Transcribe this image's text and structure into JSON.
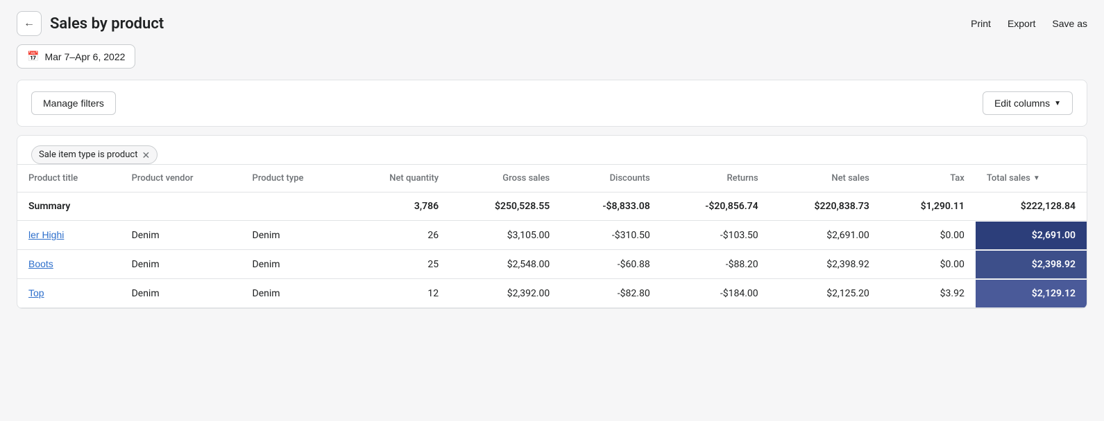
{
  "header": {
    "title": "Sales by product",
    "back_label": "←",
    "actions": {
      "print": "Print",
      "export": "Export",
      "save_as": "Save as"
    }
  },
  "date_filter": {
    "label": "Mar 7–Apr 6, 2022"
  },
  "filters_section": {
    "manage_filters_label": "Manage filters",
    "edit_columns_label": "Edit columns",
    "active_filter": "Sale item type is product"
  },
  "table": {
    "columns": [
      {
        "key": "product_title",
        "label": "Product title",
        "align": "left"
      },
      {
        "key": "product_vendor",
        "label": "Product vendor",
        "align": "left"
      },
      {
        "key": "product_type",
        "label": "Product type",
        "align": "left"
      },
      {
        "key": "net_quantity",
        "label": "Net quantity",
        "align": "right"
      },
      {
        "key": "gross_sales",
        "label": "Gross sales",
        "align": "right"
      },
      {
        "key": "discounts",
        "label": "Discounts",
        "align": "right"
      },
      {
        "key": "returns",
        "label": "Returns",
        "align": "right"
      },
      {
        "key": "net_sales",
        "label": "Net sales",
        "align": "right"
      },
      {
        "key": "tax",
        "label": "Tax",
        "align": "right"
      },
      {
        "key": "total_sales",
        "label": "Total sales",
        "align": "right",
        "sortable": true
      }
    ],
    "summary": {
      "label": "Summary",
      "net_quantity": "3,786",
      "gross_sales": "$250,528.55",
      "discounts": "-$8,833.08",
      "returns": "-$20,856.74",
      "net_sales": "$220,838.73",
      "tax": "$1,290.11",
      "total_sales": "$222,128.84"
    },
    "rows": [
      {
        "product_title": "ler Highi",
        "product_vendor": "Denim",
        "product_type": "Denim",
        "net_quantity": "26",
        "gross_sales": "$3,105.00",
        "discounts": "-$310.50",
        "returns": "-$103.50",
        "net_sales": "$2,691.00",
        "tax": "$0.00",
        "total_sales": "$2,691.00",
        "badge_shade": "1"
      },
      {
        "product_title": "Boots",
        "product_vendor": "Denim",
        "product_type": "Denim",
        "net_quantity": "25",
        "gross_sales": "$2,548.00",
        "discounts": "-$60.88",
        "returns": "-$88.20",
        "net_sales": "$2,398.92",
        "tax": "$0.00",
        "total_sales": "$2,398.92",
        "badge_shade": "2"
      },
      {
        "product_title": "Top",
        "product_vendor": "Denim",
        "product_type": "Denim",
        "net_quantity": "12",
        "gross_sales": "$2,392.00",
        "discounts": "-$82.80",
        "returns": "-$184.00",
        "net_sales": "$2,125.20",
        "tax": "$3.92",
        "total_sales": "$2,129.12",
        "badge_shade": "3"
      }
    ]
  }
}
